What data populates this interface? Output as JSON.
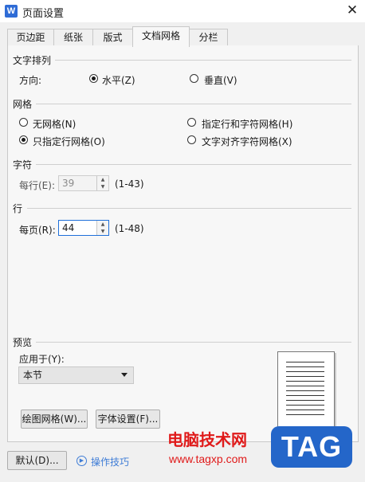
{
  "window": {
    "app_icon": "W",
    "title": "页面设置",
    "close_glyph": "✕"
  },
  "tabs": [
    {
      "label": "页边距"
    },
    {
      "label": "纸张"
    },
    {
      "label": "版式"
    },
    {
      "label": "文档网格",
      "active": true
    },
    {
      "label": "分栏"
    }
  ],
  "text_direction": {
    "section": "文字排列",
    "direction_label": "方向:",
    "horizontal": "水平(Z)",
    "vertical": "垂直(V)",
    "selected": "horizontal"
  },
  "grid": {
    "section": "网格",
    "options": [
      "无网格(N)",
      "指定行和字符网格(H)",
      "只指定行网格(O)",
      "文字对齐字符网格(X)"
    ],
    "selected": "只指定行网格(O)"
  },
  "chars": {
    "section": "字符",
    "per_line_label": "每行(E):",
    "value": "39",
    "range": "(1-43)"
  },
  "lines": {
    "section": "行",
    "per_page_label": "每页(R):",
    "value": "44",
    "range": "(1-48)"
  },
  "preview": {
    "section": "预览",
    "apply_to_label": "应用于(Y):",
    "apply_to_value": "本节"
  },
  "buttons": {
    "draw_grid": "绘图网格(W)...",
    "font_settings": "字体设置(F)...",
    "default": "默认(D)...",
    "tips": "操作技巧"
  },
  "watermark": {
    "site_name": "电脑技术网",
    "url": "www.tagxp.com",
    "badge": "TAG"
  },
  "colors": {
    "accent": "#1e6fd9",
    "link": "#3e7cd6",
    "watermark_red": "#e01a1a",
    "badge_blue": "#2466c9"
  }
}
